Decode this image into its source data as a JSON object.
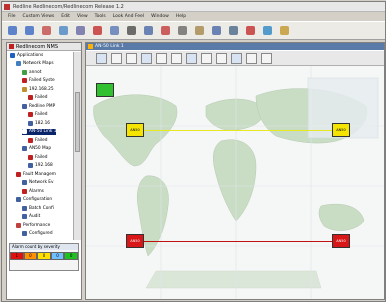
{
  "window": {
    "title": "Redline Redlinecom/Redlinecom Release 1.2"
  },
  "menu": [
    "File",
    "Custom Views",
    "Edit",
    "View",
    "Tools",
    "Look And Feel",
    "Window",
    "Help"
  ],
  "toolbar": {
    "icons": [
      "back-icon",
      "forward-icon",
      "cut-icon",
      "copy-icon",
      "paste-icon",
      "delete-icon",
      "new-icon",
      "print-icon",
      "link-icon",
      "close-icon",
      "find-icon",
      "open-icon",
      "grid-icon",
      "monitor-icon",
      "tool-icon",
      "refresh-icon",
      "help-icon"
    ]
  },
  "left_panel": {
    "title": "Redlinecom NMS",
    "tree": [
      {
        "label": "Applications",
        "indent": 0,
        "color": "#2060c0"
      },
      {
        "label": "Network Maps",
        "indent": 1,
        "color": "#4080c0"
      },
      {
        "label": "annot",
        "indent": 2,
        "color": "#40a040"
      },
      {
        "label": "Failed Syste",
        "indent": 2,
        "color": "#c02020"
      },
      {
        "label": "192.168.25",
        "indent": 2,
        "color": "#c09030"
      },
      {
        "label": "Failed",
        "indent": 3,
        "color": "#c02020"
      },
      {
        "label": "Redline PMP",
        "indent": 2,
        "color": "#4060a0"
      },
      {
        "label": "Failed",
        "indent": 3,
        "color": "#c02020"
      },
      {
        "label": "182.16",
        "indent": 3,
        "color": "#4060a0"
      },
      {
        "label": "AN-50 Link 1",
        "indent": 2,
        "color": "#ffffff",
        "selected": true
      },
      {
        "label": "Failed",
        "indent": 3,
        "color": "#c02020"
      },
      {
        "label": "AN50 Map",
        "indent": 2,
        "color": "#4060a0"
      },
      {
        "label": "Failed",
        "indent": 3,
        "color": "#c02020"
      },
      {
        "label": "192.168",
        "indent": 3,
        "color": "#4060a0"
      },
      {
        "label": "Fault Managem",
        "indent": 1,
        "color": "#c02020"
      },
      {
        "label": "Network Ev",
        "indent": 2,
        "color": "#4060a0"
      },
      {
        "label": "Alarms",
        "indent": 2,
        "color": "#c02020"
      },
      {
        "label": "Configuration",
        "indent": 1,
        "color": "#4060a0"
      },
      {
        "label": "Batch Confi",
        "indent": 2,
        "color": "#4060a0"
      },
      {
        "label": "Audit",
        "indent": 2,
        "color": "#4060a0"
      },
      {
        "label": "Performance",
        "indent": 1,
        "color": "#c04040"
      },
      {
        "label": "Configured",
        "indent": 2,
        "color": "#4060a0"
      }
    ],
    "alarm_box": {
      "title": "Alarm count by severity",
      "cells": [
        {
          "label": "1",
          "color": "#e01010"
        },
        {
          "label": "0",
          "color": "#ff9000"
        },
        {
          "label": "0",
          "color": "#ffe000"
        },
        {
          "label": "0",
          "color": "#70c0ff"
        },
        {
          "label": "0",
          "color": "#20c020"
        }
      ]
    }
  },
  "map_window": {
    "title": "AN-50 Link 1",
    "tools": [
      "select-icon",
      "move-icon",
      "pen-icon",
      "zoom-in-icon",
      "zoom-out-icon",
      "fit-icon",
      "layout-icon",
      "save-icon",
      "link-tool-icon",
      "properties-icon",
      "export-icon",
      "help-icon"
    ],
    "devices": [
      {
        "name": "green-device",
        "color": "grn",
        "label": ""
      },
      {
        "name": "yellow-device-left",
        "color": "yel",
        "label": "AN50"
      },
      {
        "name": "yellow-device-right",
        "color": "yel",
        "label": "AN50"
      },
      {
        "name": "red-device-left",
        "color": "red",
        "label": "AN50"
      },
      {
        "name": "red-device-right",
        "color": "red",
        "label": "AN50"
      }
    ],
    "link_colors": {
      "ok": "#e8e820",
      "fail": "#c01010"
    }
  }
}
